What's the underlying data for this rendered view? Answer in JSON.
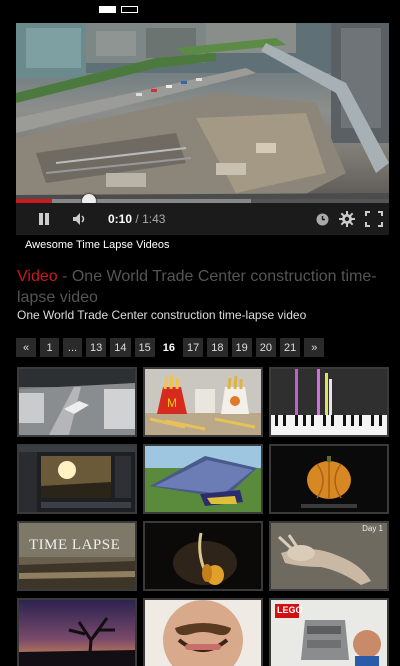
{
  "player": {
    "current_time": "0:10",
    "separator": "/",
    "duration": "1:43",
    "progress_fraction": 0.097,
    "buffered_fraction": 0.63
  },
  "channel_name": "Awesome Time Lapse Videos",
  "video": {
    "category": "Video",
    "dash": " - ",
    "title": "One World Trade Center construction time-lapse video",
    "subtitle": "One World Trade Center construction time-lapse video"
  },
  "pagination": {
    "prev": "«",
    "pages": [
      "1",
      "...",
      "13",
      "14",
      "15",
      "16",
      "17",
      "18",
      "19",
      "20",
      "21"
    ],
    "current": "16",
    "next": "»"
  },
  "thumbnails": [
    {
      "name": "thumb-airport-runway",
      "caption": ""
    },
    {
      "name": "thumb-fast-food-fries",
      "caption": ""
    },
    {
      "name": "thumb-piano-synthesia",
      "caption": ""
    },
    {
      "name": "thumb-sunset-editor",
      "caption": ""
    },
    {
      "name": "thumb-wave-animation",
      "caption": ""
    },
    {
      "name": "thumb-pumpkin-rot",
      "caption": ""
    },
    {
      "name": "thumb-time-lapse-title",
      "caption": "TIME LAPSE"
    },
    {
      "name": "thumb-sprouting-seed",
      "caption": ""
    },
    {
      "name": "thumb-rabbit-decay",
      "caption": "Day 1"
    },
    {
      "name": "thumb-night-tree",
      "caption": ""
    },
    {
      "name": "thumb-mustache-man",
      "caption": ""
    },
    {
      "name": "thumb-lego-death-star",
      "caption": "LEGO"
    }
  ],
  "colors": {
    "accent": "#cc181e",
    "background": "#000000"
  }
}
